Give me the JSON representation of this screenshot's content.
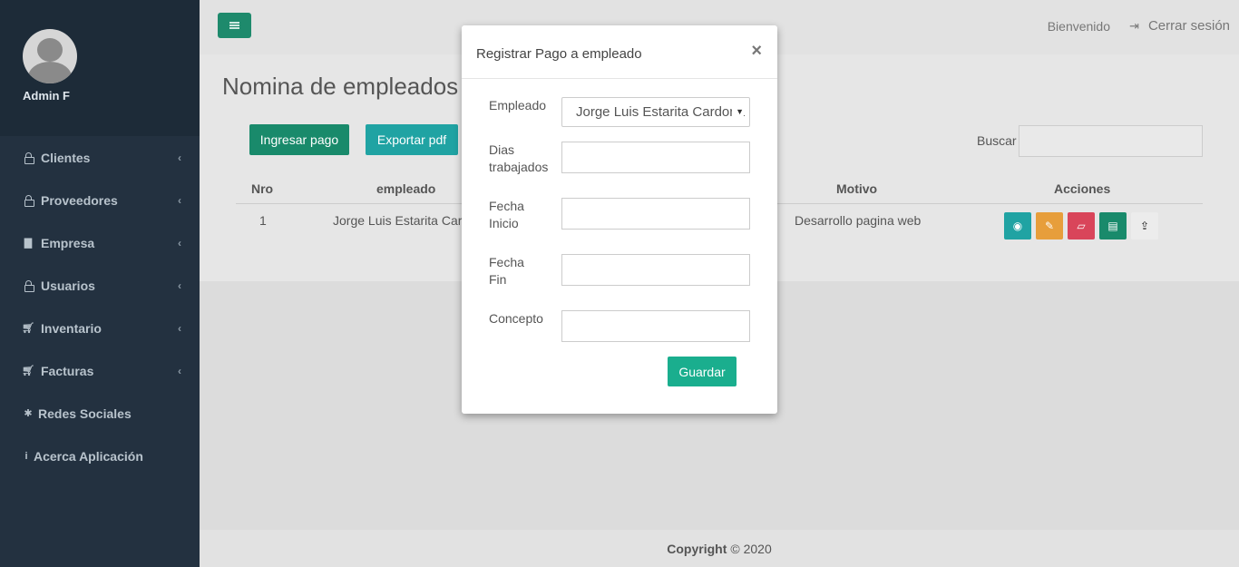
{
  "sidebar": {
    "user_name": "Admin F",
    "items": [
      {
        "label": "Clientes",
        "icon": "lock-icon"
      },
      {
        "label": "Proveedores",
        "icon": "lock-icon"
      },
      {
        "label": "Empresa",
        "icon": "building-icon"
      },
      {
        "label": "Usuarios",
        "icon": "lock-icon"
      },
      {
        "label": "Inventario",
        "icon": "cart-icon"
      },
      {
        "label": "Facturas",
        "icon": "cart-icon"
      },
      {
        "label": "Redes Sociales",
        "icon": "gear-icon"
      },
      {
        "label": "Acerca Aplicación",
        "icon": "info-icon"
      }
    ]
  },
  "topbar": {
    "welcome": "Bienvenido",
    "logout": "Cerrar sesión"
  },
  "main": {
    "title": "Nomina de empleados",
    "buttons": {
      "add_payment": "Ingresar pago",
      "export_pdf": "Exportar pdf"
    },
    "search_label": "Buscar",
    "table": {
      "headers": [
        "Nro",
        "empleado",
        "Motivo",
        "Acciones"
      ],
      "rows": [
        {
          "nro": "1",
          "empleado": "Jorge Luis Estarita Cardona",
          "motivo": "Desarrollo pagina web"
        }
      ]
    }
  },
  "modal": {
    "title": "Registrar Pago a empleado",
    "close": "×",
    "fields": {
      "employee_label": "Empleado",
      "employee_value": "Jorge Luis Estarita Cardona",
      "days_label_1": "Dias",
      "days_label_2": "trabajados",
      "start_label_1": "Fecha",
      "start_label_2": "Inicio",
      "end_label_1": "Fecha",
      "end_label_2": "Fin",
      "concept_label": "Concepto"
    },
    "save": "Guardar"
  },
  "footer": {
    "copyright_bold": "Copyright",
    "copyright_rest": "© 2020"
  },
  "colors": {
    "sidebar": "#233140",
    "primary": "#198a6b",
    "teal": "#20a3a3",
    "save": "#1aae8e"
  }
}
